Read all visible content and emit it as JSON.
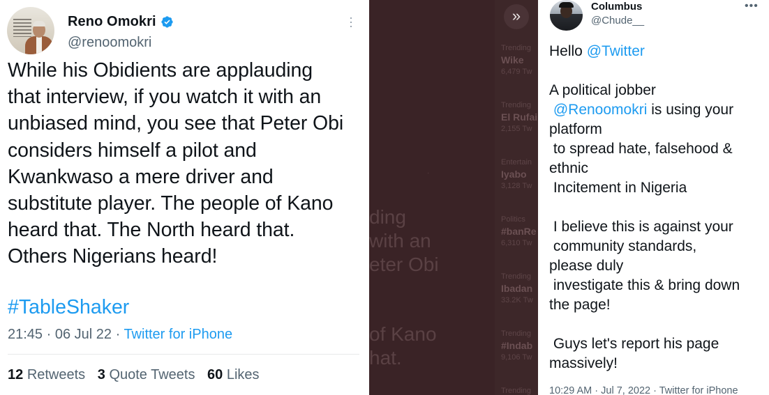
{
  "left_tweet": {
    "author_name": "Reno Omokri",
    "author_handle": "@renoomokri",
    "text_lines": [
      "While his Obidients are applauding",
      "that interview, if you watch it with an",
      "unbiased mind, you see that Peter Obi",
      "considers himself a pilot and",
      "Kwankwaso a mere driver and",
      "substitute player. The people of Kano",
      "heard that. The North heard that.",
      "Others Nigerians heard!"
    ],
    "hashtag": "#TableShaker",
    "time": "21:45",
    "date": "06 Jul 22",
    "source": "Twitter for iPhone",
    "retweets_count": "12",
    "retweets_label": "Retweets",
    "quote_count": "3",
    "quote_label": "Quote Tweets",
    "likes_count": "60",
    "likes_label": "Likes",
    "accent_color": "#1d9bf0"
  },
  "middle_overlay": {
    "ghost_text": [
      "ding",
      "with an",
      "eter Obi",
      "of Kano",
      "hat."
    ],
    "trends": [
      {
        "category": "Trending",
        "name": "Wike",
        "count": "6,479 Tw"
      },
      {
        "category": "Trending",
        "name": "El Rufai",
        "count": "2,155 Tw"
      },
      {
        "category": "Entertain",
        "name": "Iyabo",
        "count": "3,128 Tw"
      },
      {
        "category": "Politics",
        "name": "#banRe",
        "count": "6,310 Tw"
      },
      {
        "category": "Trending",
        "name": "Ibadan",
        "count": "33.2K Tw"
      },
      {
        "category": "Trending",
        "name": "#Indab",
        "count": "9,106 Tw"
      },
      {
        "category": "Trending",
        "name": "",
        "count": ""
      }
    ]
  },
  "right_tweet": {
    "author_name": "Columbus",
    "author_handle": "@Chude__",
    "lines": [
      {
        "pre": "Hello ",
        "mention": "@Twitter",
        "post": ""
      },
      {
        "pre": "",
        "mention": "",
        "post": ""
      },
      {
        "pre": "A political jobber",
        "mention": "",
        "post": ""
      },
      {
        "pre": " ",
        "mention": "@Renoomokri",
        "post": " is using your"
      },
      {
        "pre": "platform",
        "mention": "",
        "post": ""
      },
      {
        "pre": " to spread hate, falsehood &",
        "mention": "",
        "post": ""
      },
      {
        "pre": "ethnic",
        "mention": "",
        "post": ""
      },
      {
        "pre": " Incitement in Nigeria",
        "mention": "",
        "post": ""
      },
      {
        "pre": "",
        "mention": "",
        "post": ""
      },
      {
        "pre": " I believe this is against your",
        "mention": "",
        "post": ""
      },
      {
        "pre": " community standards,",
        "mention": "",
        "post": ""
      },
      {
        "pre": "please duly",
        "mention": "",
        "post": ""
      },
      {
        "pre": " investigate this & bring down",
        "mention": "",
        "post": ""
      },
      {
        "pre": "the page!",
        "mention": "",
        "post": ""
      },
      {
        "pre": "",
        "mention": "",
        "post": ""
      },
      {
        "pre": " Guys let's report his page",
        "mention": "",
        "post": ""
      },
      {
        "pre": "massively!",
        "mention": "",
        "post": ""
      }
    ],
    "meta": "10:29 AM · Jul 7, 2022 · Twitter for iPhone"
  }
}
